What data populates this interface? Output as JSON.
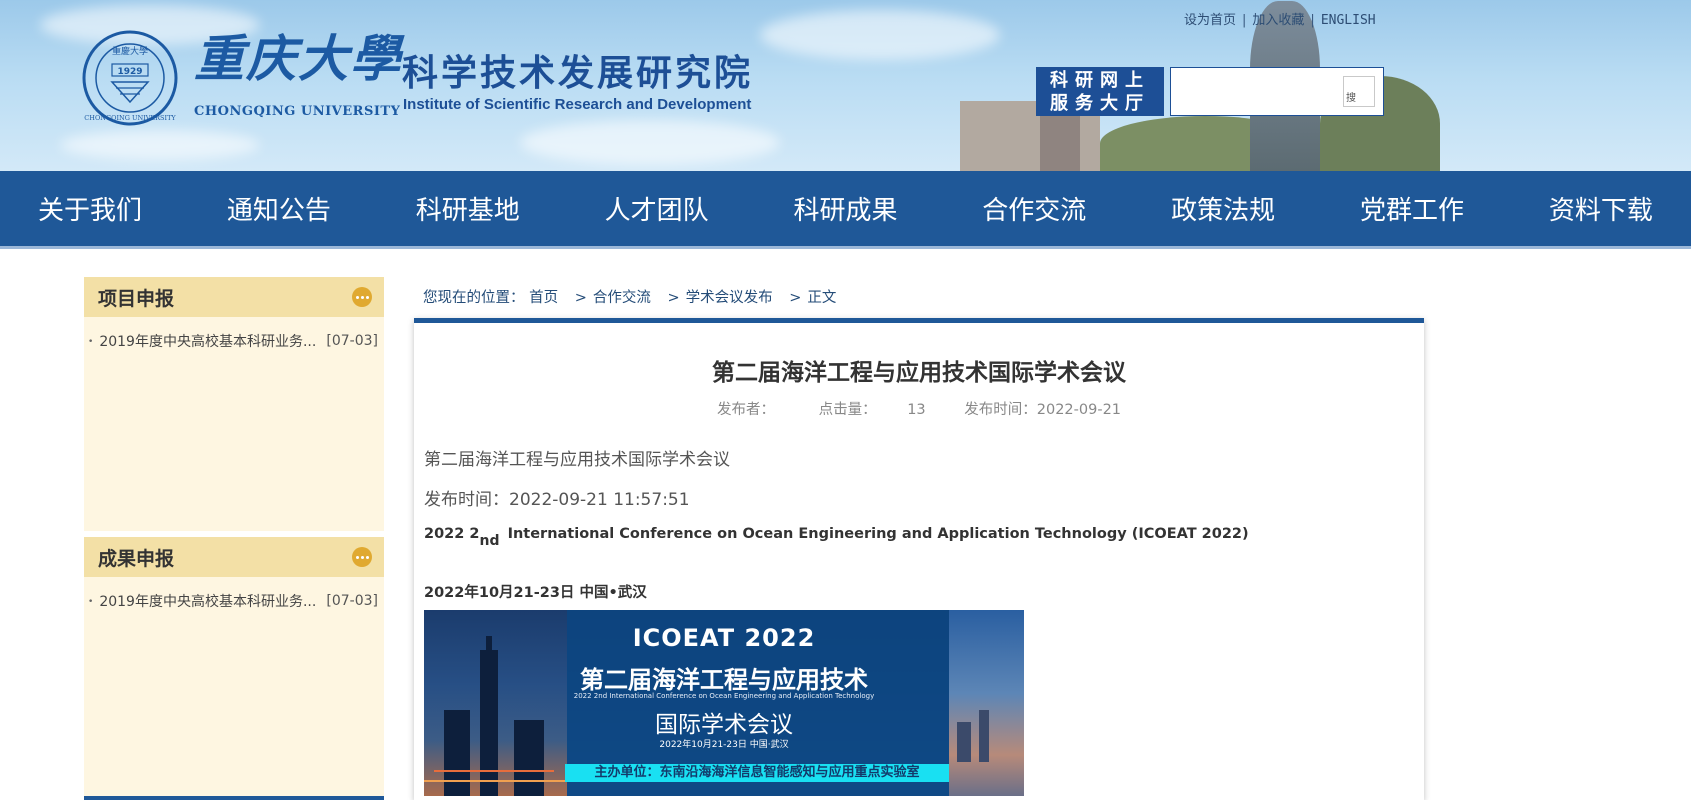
{
  "header": {
    "univ_name_cn": "重庆大學",
    "univ_name_en": "CHONGQING UNIVERSITY",
    "seal_year": "1929",
    "institute_cn": "科学技术发展研究院",
    "institute_en": "Institute of Scientific Research and Development",
    "top_links": [
      "设为首页",
      "加入收藏",
      "ENGLISH"
    ],
    "online_hall_line1": "科研网上",
    "online_hall_line2": "服务大厅",
    "search_value": "",
    "search_button_label": "搜"
  },
  "nav": {
    "items": [
      "关于我们",
      "通知公告",
      "科研基地",
      "人才团队",
      "科研成果",
      "合作交流",
      "政策法规",
      "党群工作",
      "资料下载"
    ]
  },
  "sidebar": {
    "blocks": [
      {
        "title": "项目申报",
        "items": [
          {
            "text": "2019年度中央高校基本科研业务...",
            "date": "[07-03]"
          }
        ]
      },
      {
        "title": "成果申报",
        "items": [
          {
            "text": "2019年度中央高校基本科研业务...",
            "date": "[07-03]"
          }
        ]
      }
    ]
  },
  "breadcrumb": {
    "prefix": "您现在的位置：",
    "items": [
      "首页",
      "合作交流",
      "学术会议发布",
      "正文"
    ]
  },
  "article": {
    "title": "第二届海洋工程与应用技术国际学术会议",
    "meta": {
      "publisher": "发布者：",
      "clicks_label": "点击量：",
      "clicks": "13",
      "pub_time": "发布时间：2022-09-21"
    },
    "para1": "第二届海洋工程与应用技术国际学术会议",
    "para2": "发布时间：2022-09-21 11:57:51",
    "en_pre": "2022 2",
    "en_sub": "nd",
    "en_post": "International Conference on Ocean Engineering and Application Technology (ICOEAT 2022)",
    "date_place": "2022年10月21-23日 中国•武汉",
    "banner": {
      "code": "ICOEAT  2022",
      "cn_title": "第二届海洋工程与应用技术",
      "en_title": "2022 2nd International Conference on Ocean Engineering and Application Technology",
      "cn_title2": "国际学术会议",
      "date": "2022年10月21-23日  中国·武汉",
      "host": "主办单位：东南沿海海洋信息智能感知与应用重点实验室"
    }
  }
}
